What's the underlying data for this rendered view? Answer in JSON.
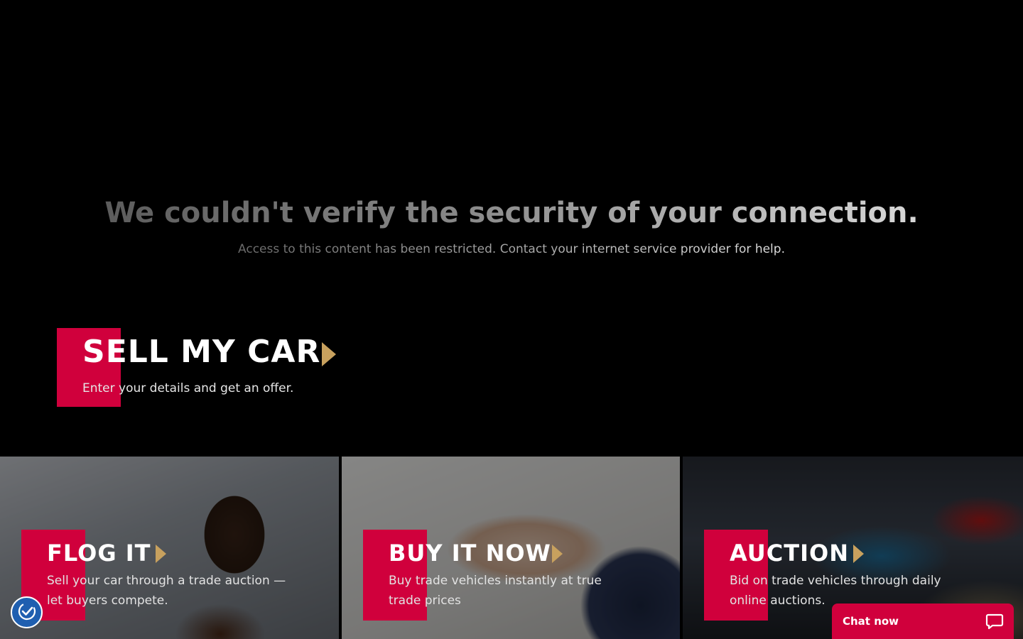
{
  "error": {
    "title": "We couldn't verify the security of your connection.",
    "subtitle": "Access to this content has been restricted. Contact your internet service provider for help."
  },
  "hero": {
    "title": "SELL MY CAR",
    "subtitle": "Enter your details and get an offer."
  },
  "cards": [
    {
      "title": "FLOG IT",
      "description": "Sell your car through a trade auction — let buyers compete."
    },
    {
      "title": "BUY IT NOW",
      "description": "Buy trade vehicles instantly at true trade prices"
    },
    {
      "title": "AUCTION",
      "description": "Bid on trade vehicles through daily online auctions."
    }
  ],
  "chat": {
    "label": "Chat now"
  },
  "icons": {
    "accessibility": "accessibility-icon",
    "chat": "chat-bubble-icon",
    "arrow": "play-arrow-icon"
  },
  "colors": {
    "accent_red": "#d0003c",
    "arrow_gold": "#c8a15e",
    "background": "#000000",
    "accessibility_blue": "#1f5fb0"
  }
}
